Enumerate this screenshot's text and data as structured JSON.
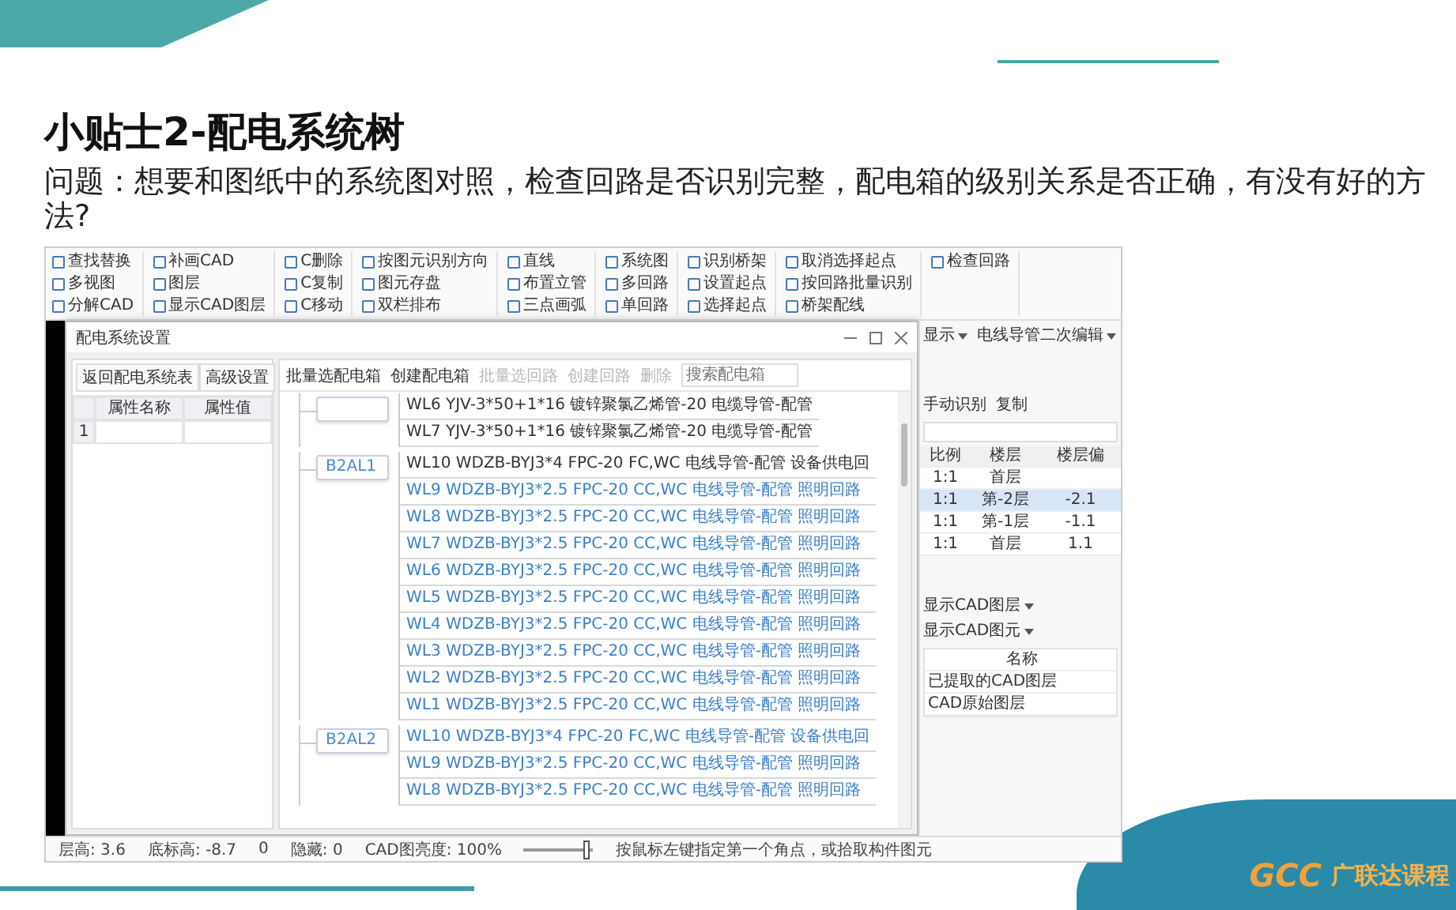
{
  "slide": {
    "title": "小贴士2-配电系统树",
    "question": "问题：想要和图纸中的系统图对照，检查回路是否识别完整，配电箱的级别关系是否正确，有没有好的方法?"
  },
  "ribbon": {
    "groups": [
      {
        "items": [
          "查找替换",
          "多视图",
          "分解CAD"
        ]
      },
      {
        "items": [
          "补画CAD",
          "图层",
          "显示CAD图层"
        ]
      },
      {
        "items": [
          "C删除",
          "C复制",
          "C移动"
        ]
      },
      {
        "items": [
          "按图元识别方向",
          "图元存盘",
          "双栏排布"
        ]
      },
      {
        "items": [
          "直线",
          "布置立管",
          "三点画弧"
        ]
      },
      {
        "items": [
          "系统图",
          "多回路",
          "单回路"
        ]
      },
      {
        "items": [
          "识别桥架",
          "设置起点",
          "选择起点"
        ]
      },
      {
        "items": [
          "取消选择起点",
          "按回路批量识别",
          "桥架配线"
        ]
      },
      {
        "items": [
          "检查回路"
        ]
      }
    ]
  },
  "dialog": {
    "title": "配电系统设置",
    "left": {
      "buttons": [
        "返回配电系统表",
        "高级设置"
      ],
      "columns": [
        "属性名称",
        "属性值"
      ],
      "rows": [
        "1"
      ]
    },
    "toolbar": [
      {
        "label": "批量选配电箱",
        "disabled": false
      },
      {
        "label": "创建配电箱",
        "disabled": false
      },
      {
        "label": "批量选回路",
        "disabled": true
      },
      {
        "label": "创建回路",
        "disabled": true
      },
      {
        "label": "删除",
        "disabled": true
      }
    ],
    "search": {
      "placeholder": "搜索配电箱"
    },
    "tree": [
      {
        "circuits": [
          {
            "text": "WL6 YJV-3*50+1*16 镀锌聚氯乙烯管-20 电缆导管-配管",
            "highlighted": false
          },
          {
            "text": "WL7 YJV-3*50+1*16 镀锌聚氯乙烯管-20 电缆导管-配管",
            "highlighted": false
          }
        ]
      },
      {
        "name": "B2AL1",
        "circuits": [
          {
            "text": "WL10 WDZB-BYJ3*4 FPC-20 FC,WC 电线导管-配管 设备供电回",
            "highlighted": false
          },
          {
            "text": "WL9 WDZB-BYJ3*2.5 FPC-20 CC,WC 电线导管-配管 照明回路",
            "highlighted": true
          },
          {
            "text": "WL8 WDZB-BYJ3*2.5 FPC-20 CC,WC 电线导管-配管 照明回路",
            "highlighted": true
          },
          {
            "text": "WL7 WDZB-BYJ3*2.5 FPC-20 CC,WC 电线导管-配管 照明回路",
            "highlighted": true
          },
          {
            "text": "WL6 WDZB-BYJ3*2.5 FPC-20 CC,WC 电线导管-配管 照明回路",
            "highlighted": true
          },
          {
            "text": "WL5 WDZB-BYJ3*2.5 FPC-20 CC,WC 电线导管-配管 照明回路",
            "highlighted": true
          },
          {
            "text": "WL4 WDZB-BYJ3*2.5 FPC-20 CC,WC 电线导管-配管 照明回路",
            "highlighted": true
          },
          {
            "text": "WL3 WDZB-BYJ3*2.5 FPC-20 CC,WC 电线导管-配管 照明回路",
            "highlighted": true
          },
          {
            "text": "WL2 WDZB-BYJ3*2.5 FPC-20 CC,WC 电线导管-配管 照明回路",
            "highlighted": true
          },
          {
            "text": "WL1 WDZB-BYJ3*2.5 FPC-20 CC,WC 电线导管-配管 照明回路",
            "highlighted": true
          }
        ]
      },
      {
        "name": "B2AL2",
        "circuits": [
          {
            "text": "WL10 WDZB-BYJ3*4 FPC-20 FC,WC 电线导管-配管 设备供电回",
            "highlighted": true
          },
          {
            "text": "WL9 WDZB-BYJ3*2.5 FPC-20 CC,WC 电线导管-配管 照明回路",
            "highlighted": true
          },
          {
            "text": "WL8 WDZB-BYJ3*2.5 FPC-20 CC,WC 电线导管-配管 照明回路",
            "highlighted": true
          }
        ]
      }
    ]
  },
  "right_panel": {
    "menus": [
      "显示",
      "电线导管二次编辑"
    ],
    "toolbar": [
      "手动识别",
      "复制"
    ],
    "table": {
      "columns": [
        "比例",
        "楼层",
        "楼层偏"
      ],
      "rows": [
        {
          "cells": [
            "1:1",
            "首层"
          ],
          "selected": false
        },
        {
          "cells": [
            "1:1",
            "第-2层",
            "-2.1"
          ],
          "selected": true
        },
        {
          "cells": [
            "1:1",
            "第-1层",
            "-1.1"
          ],
          "selected": false
        },
        {
          "cells": [
            "1:1",
            "首层",
            "1.1"
          ],
          "selected": false
        }
      ]
    },
    "layers": {
      "tabs": [
        "显示CAD图层",
        "显示CAD图元"
      ],
      "column": "名称",
      "rows": [
        "已提取的CAD图层",
        "CAD原始图层"
      ]
    }
  },
  "status_bar": {
    "items": [
      "层高: 3.6",
      "底标高: -8.7",
      "0",
      "隐藏: 0"
    ],
    "brightness_label": "CAD图亮度: 100%",
    "brightness": {
      "level": 0.9
    },
    "hint": "按鼠标左键指定第一个角点，或拾取构件图元"
  },
  "brand": {
    "mark": "GCC",
    "name": "广联达课程"
  }
}
